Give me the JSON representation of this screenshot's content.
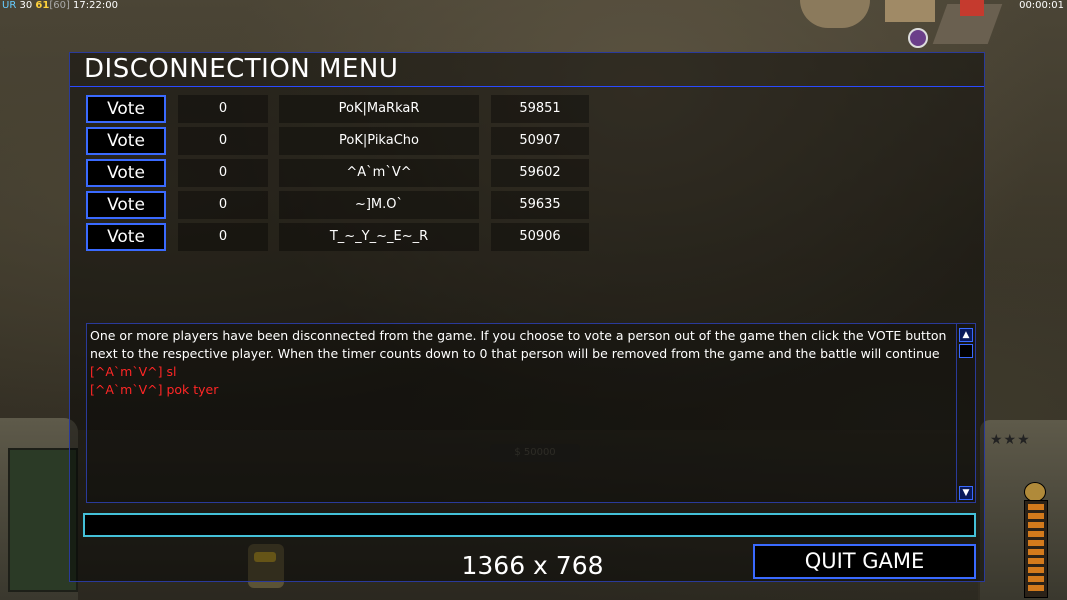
{
  "hud": {
    "ur_label": "UR",
    "ur_value": "30",
    "fps": "61",
    "fps_cap": "[60]",
    "clock": "17:22:00",
    "timer": "00:00:01"
  },
  "money_display": "$ 50000",
  "dialog": {
    "title": "DISCONNECTION MENU",
    "vote_label": "Vote",
    "players": [
      {
        "votes": "0",
        "name": "PoK|MaRkaR",
        "ping": "59851"
      },
      {
        "votes": "0",
        "name": "PoK|PikaCho",
        "ping": "50907"
      },
      {
        "votes": "0",
        "name": "^A`m`V^",
        "ping": "59602"
      },
      {
        "votes": "0",
        "name": "~]M.O`",
        "ping": "59635"
      },
      {
        "votes": "0",
        "name": "T_~_Y_~_E~_R",
        "ping": "50906"
      }
    ],
    "chat": {
      "system_message": "One or more players have been disconnected from the game. If you choose to vote a person out of the game then click the VOTE button next to the respective player. When the timer counts down to 0 that person will be removed from the game and the battle will continue",
      "messages": [
        "[^A`m`V^] sl",
        "[^A`m`V^] pok tyer"
      ]
    },
    "chat_input_value": "",
    "resolution_label": "1366 x 768",
    "quit_label": "QUIT GAME"
  },
  "colors": {
    "border_blue": "#3a6aff",
    "input_cyan": "#44c0d8",
    "chat_red": "#ff2626"
  }
}
